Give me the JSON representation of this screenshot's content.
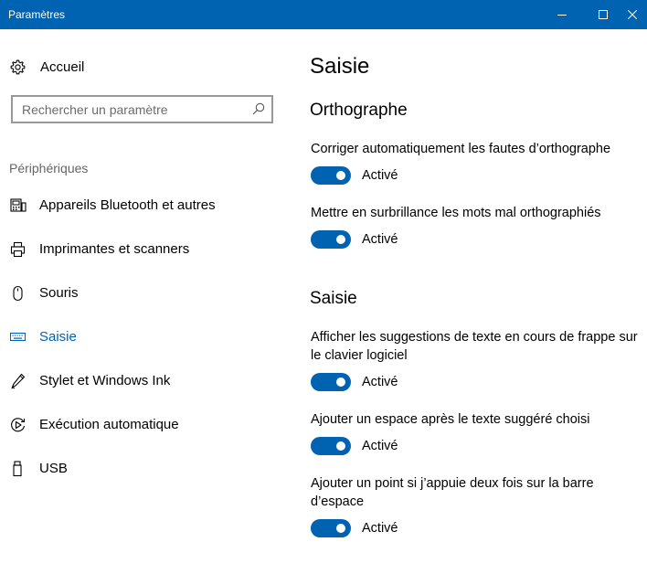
{
  "window": {
    "title": "Paramètres"
  },
  "sidebar": {
    "home_label": "Accueil",
    "search_placeholder": "Rechercher un paramètre",
    "section_label": "Périphériques",
    "items": [
      {
        "label": "Appareils Bluetooth et autres",
        "icon": "bluetooth-devices-icon",
        "active": false
      },
      {
        "label": "Imprimantes et scanners",
        "icon": "printer-icon",
        "active": false
      },
      {
        "label": "Souris",
        "icon": "mouse-icon",
        "active": false
      },
      {
        "label": "Saisie",
        "icon": "keyboard-icon",
        "active": true
      },
      {
        "label": "Stylet et Windows Ink",
        "icon": "pen-icon",
        "active": false
      },
      {
        "label": "Exécution automatique",
        "icon": "autoplay-icon",
        "active": false
      },
      {
        "label": "USB",
        "icon": "usb-icon",
        "active": false
      }
    ]
  },
  "main": {
    "title": "Saisie",
    "sections": [
      {
        "heading": "Orthographe",
        "settings": [
          {
            "label": "Corriger automatiquement les fautes d’orthographe",
            "state": "Activé",
            "on": true
          },
          {
            "label": "Mettre en surbrillance les mots mal orthographiés",
            "state": "Activé",
            "on": true
          }
        ]
      },
      {
        "heading": "Saisie",
        "settings": [
          {
            "label": "Afficher les suggestions de texte en cours de frappe sur le clavier logiciel",
            "state": "Activé",
            "on": true
          },
          {
            "label": "Ajouter un espace après le texte suggéré choisi",
            "state": "Activé",
            "on": true
          },
          {
            "label": "Ajouter un point si j’appuie deux fois sur la barre d’espace",
            "state": "Activé",
            "on": true
          }
        ]
      }
    ]
  },
  "colors": {
    "accent": "#0063b1",
    "toggle_on": "#0063b1",
    "section_label": "#666666"
  }
}
